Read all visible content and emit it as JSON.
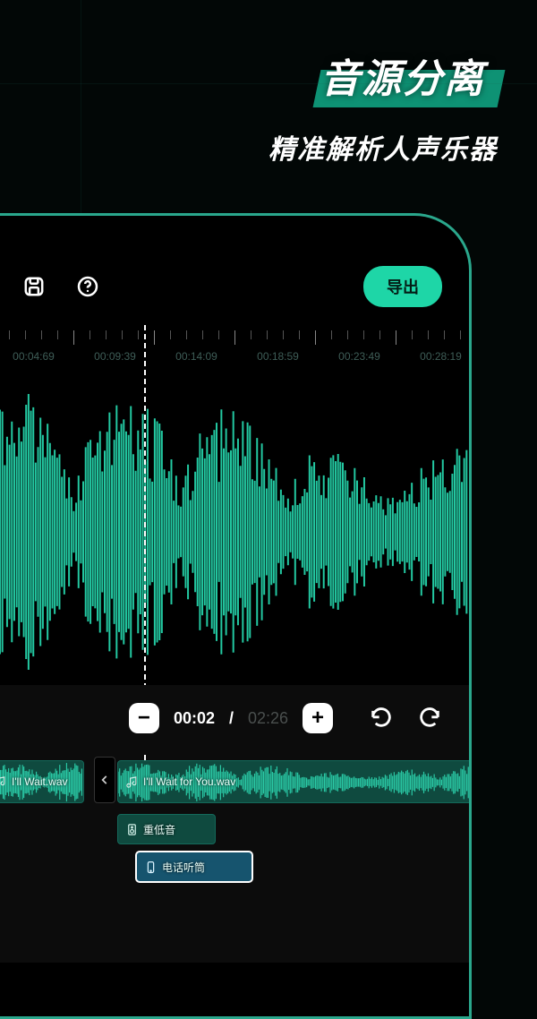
{
  "header": {
    "title": "音源分离",
    "subtitle": "精准解析人声乐器"
  },
  "toolbar": {
    "export_label": "导出"
  },
  "ruler": {
    "labels": [
      "00:04:69",
      "00:09:39",
      "00:14:09",
      "00:18:59",
      "00:23:49",
      "00:28:19"
    ]
  },
  "transport": {
    "current": "00:02",
    "total": "02:26"
  },
  "tracks": {
    "clip_a_label": "I'll Wait.wav",
    "clip_b_label": "I'll Wait for You.wav",
    "effect1_label": "重低音",
    "effect2_label": "电话听筒"
  },
  "colors": {
    "accent": "#1ed6a7",
    "wave": "#23c9a2"
  }
}
